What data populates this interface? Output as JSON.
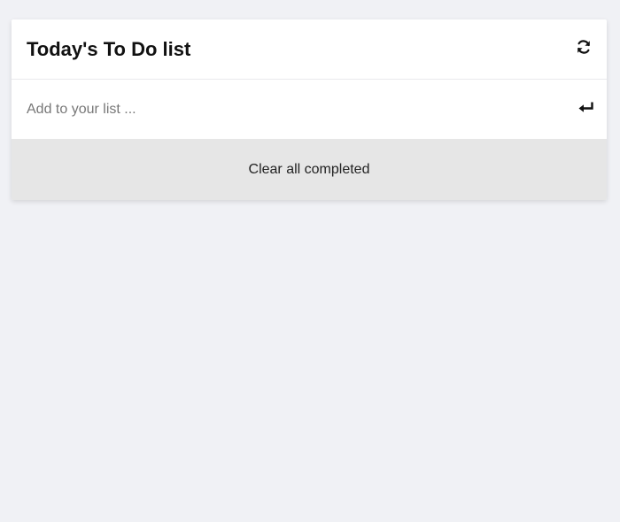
{
  "header": {
    "title": "Today's To Do list",
    "refresh_icon": "refresh-icon"
  },
  "add_item": {
    "value": "",
    "placeholder": "Add to your list ...",
    "submit_icon": "enter-icon"
  },
  "actions": {
    "clear_completed_label": "Clear all completed"
  },
  "colors": {
    "background": "#f0f1f5",
    "card": "#ffffff",
    "clear_button_bg": "#e6e6e6",
    "text": "#111111"
  }
}
